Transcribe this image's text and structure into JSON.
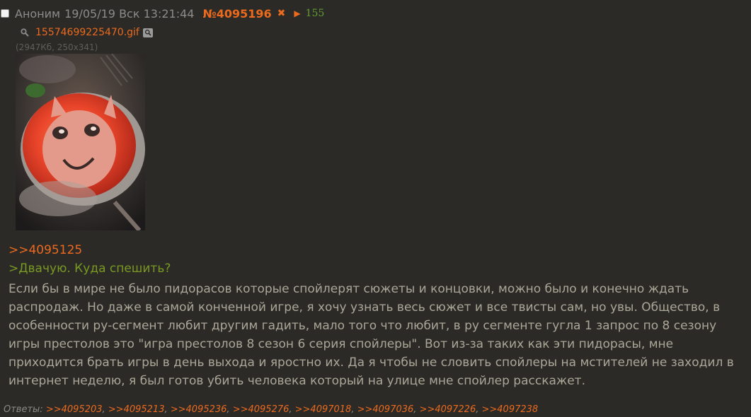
{
  "post": {
    "author": "Аноним",
    "datetime": "19/05/19 Вск 13:21:44",
    "number": "№4095196",
    "hide_symbol": "✖",
    "play_symbol": "▶",
    "count": "155"
  },
  "file": {
    "name": "15574699225470.gif",
    "meta": "(2947Кб, 250x341)",
    "icons": [
      "magnifier-icon",
      "image-search-icon"
    ]
  },
  "message": {
    "reply_to": ">>4095125",
    "quote": ">Двачую. Куда спешить?",
    "text": "Если бы в мире не было пидорасов которые спойлерят сюжеты и концовки, можно было и конечно ждать распродаж. Но даже в самой конченной игре, я хочу узнать весь сюжет и все твисты сам, но увы. Общество, в особенности ру-сегмент любит другим гадить, мало того что любит, в ру сегменте гугла 1 запрос по 8 сезону игры престолов это \"игра престолов 8 сезон 6 серия спойлеры\". Вот из-за таких как эти пидорасы, мне приходится брать игры в день выхода и яростно их. Да я чтобы не словить спойлеры на мстителей не заходил в интернет неделю, я был готов убить человека который на улице мне спойлер расскажет."
  },
  "replies": {
    "label": "Ответы:",
    "links": [
      ">>4095203",
      ">>4095213",
      ">>4095236",
      ">>4095276",
      ">>4097018",
      ">>4097036",
      ">>4097226",
      ">>4097238"
    ]
  },
  "colors": {
    "background": "#2b2a27",
    "accent": "#ec6a1e",
    "quote": "#789922",
    "counter": "#5e9e32",
    "text": "#aba798"
  }
}
